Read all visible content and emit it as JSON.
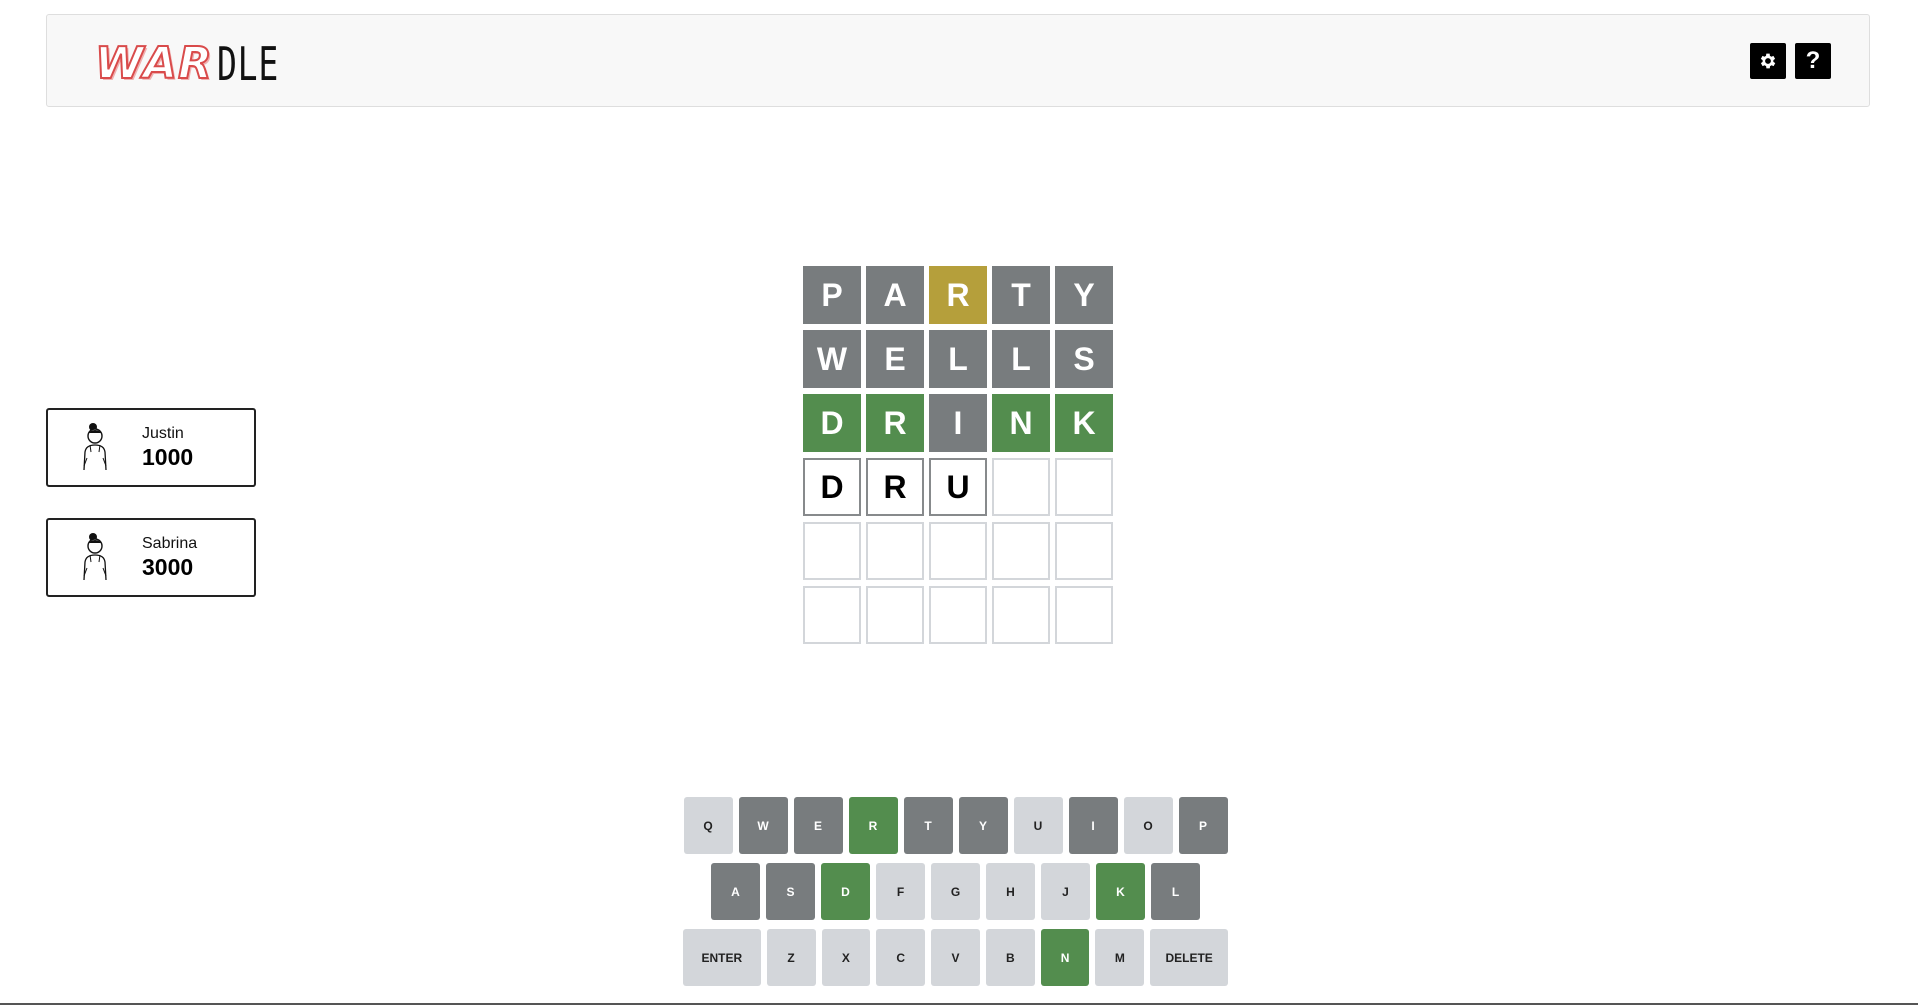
{
  "header": {
    "logo_war": "WAR",
    "logo_dle": "DLE",
    "settings_icon": "gear-icon",
    "help_label": "?"
  },
  "players": [
    {
      "name": "Justin",
      "score": "1000",
      "avatar_icon": "person-avatar-icon"
    },
    {
      "name": "Sabrina",
      "score": "3000",
      "avatar_icon": "person-avatar-icon"
    }
  ],
  "board": {
    "rows": [
      [
        {
          "letter": "P",
          "state": "absent"
        },
        {
          "letter": "A",
          "state": "absent"
        },
        {
          "letter": "R",
          "state": "present"
        },
        {
          "letter": "T",
          "state": "absent"
        },
        {
          "letter": "Y",
          "state": "absent"
        }
      ],
      [
        {
          "letter": "W",
          "state": "absent"
        },
        {
          "letter": "E",
          "state": "absent"
        },
        {
          "letter": "L",
          "state": "absent"
        },
        {
          "letter": "L",
          "state": "absent"
        },
        {
          "letter": "S",
          "state": "absent"
        }
      ],
      [
        {
          "letter": "D",
          "state": "correct"
        },
        {
          "letter": "R",
          "state": "correct"
        },
        {
          "letter": "I",
          "state": "absent"
        },
        {
          "letter": "N",
          "state": "correct"
        },
        {
          "letter": "K",
          "state": "correct"
        }
      ],
      [
        {
          "letter": "D",
          "state": "typed"
        },
        {
          "letter": "R",
          "state": "typed"
        },
        {
          "letter": "U",
          "state": "typed"
        },
        {
          "letter": "",
          "state": "empty"
        },
        {
          "letter": "",
          "state": "empty"
        }
      ],
      [
        {
          "letter": "",
          "state": "empty"
        },
        {
          "letter": "",
          "state": "empty"
        },
        {
          "letter": "",
          "state": "empty"
        },
        {
          "letter": "",
          "state": "empty"
        },
        {
          "letter": "",
          "state": "empty"
        }
      ],
      [
        {
          "letter": "",
          "state": "empty"
        },
        {
          "letter": "",
          "state": "empty"
        },
        {
          "letter": "",
          "state": "empty"
        },
        {
          "letter": "",
          "state": "empty"
        },
        {
          "letter": "",
          "state": "empty"
        }
      ]
    ]
  },
  "keyboard": {
    "rows": [
      [
        {
          "label": "Q",
          "state": "unused"
        },
        {
          "label": "W",
          "state": "absent"
        },
        {
          "label": "E",
          "state": "absent"
        },
        {
          "label": "R",
          "state": "correct"
        },
        {
          "label": "T",
          "state": "absent"
        },
        {
          "label": "Y",
          "state": "absent"
        },
        {
          "label": "U",
          "state": "unused"
        },
        {
          "label": "I",
          "state": "absent"
        },
        {
          "label": "O",
          "state": "unused"
        },
        {
          "label": "P",
          "state": "absent"
        }
      ],
      [
        {
          "label": "A",
          "state": "absent"
        },
        {
          "label": "S",
          "state": "absent"
        },
        {
          "label": "D",
          "state": "correct"
        },
        {
          "label": "F",
          "state": "unused"
        },
        {
          "label": "G",
          "state": "unused"
        },
        {
          "label": "H",
          "state": "unused"
        },
        {
          "label": "J",
          "state": "unused"
        },
        {
          "label": "K",
          "state": "correct"
        },
        {
          "label": "L",
          "state": "absent"
        }
      ],
      [
        {
          "label": "ENTER",
          "state": "unused",
          "wide": true
        },
        {
          "label": "Z",
          "state": "unused"
        },
        {
          "label": "X",
          "state": "unused"
        },
        {
          "label": "C",
          "state": "unused"
        },
        {
          "label": "V",
          "state": "unused"
        },
        {
          "label": "B",
          "state": "unused"
        },
        {
          "label": "N",
          "state": "correct"
        },
        {
          "label": "M",
          "state": "unused"
        },
        {
          "label": "DELETE",
          "state": "unused",
          "wide": true
        }
      ]
    ]
  },
  "colors": {
    "absent": "#787c7e",
    "present": "#b59f3b",
    "correct": "#538d4e",
    "unused_key": "#d3d6da",
    "logo_red": "#d94b4b"
  }
}
